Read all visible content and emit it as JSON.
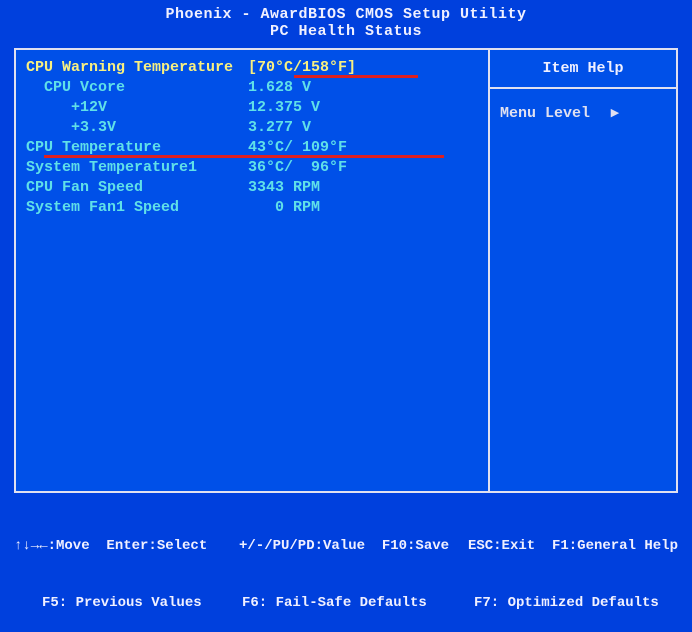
{
  "header": {
    "line1": "Phoenix - AwardBIOS CMOS Setup Utility",
    "line2": "PC Health Status"
  },
  "items": [
    {
      "label": "CPU Warning Temperature",
      "value": "[70°C/158°F]",
      "labelClass": "yellow",
      "valueClass": "yellow",
      "indent": 0,
      "hl": "underline1"
    },
    {
      "label": "CPU Vcore",
      "value": "1.628 V",
      "labelClass": "cyan",
      "valueClass": "cyan",
      "indent": 2
    },
    {
      "label": "+12V",
      "value": "12.375 V",
      "labelClass": "cyan",
      "valueClass": "cyan",
      "indent": 5
    },
    {
      "label": "+3.3V",
      "value": "3.277 V",
      "labelClass": "cyan",
      "valueClass": "cyan",
      "indent": 5
    },
    {
      "label": "CPU Temperature",
      "value": "43°C/ 109°F",
      "labelClass": "cyan",
      "valueClass": "cyan",
      "indent": 0,
      "hl": "underline2"
    },
    {
      "label": "System Temperature1",
      "value": "36°C/  96°F",
      "labelClass": "cyan",
      "valueClass": "cyan",
      "indent": 0
    },
    {
      "label": "CPU Fan Speed",
      "value": "3343 RPM",
      "labelClass": "cyan",
      "valueClass": "cyan",
      "indent": 0
    },
    {
      "label": "System Fan1 Speed",
      "value": "   0 RPM",
      "labelClass": "cyan",
      "valueClass": "cyan",
      "indent": 0
    }
  ],
  "help": {
    "title": "Item Help",
    "menuLevel": "Menu Level",
    "chevron": "▸"
  },
  "footer": {
    "r1c1": "↑↓→←:Move  Enter:Select",
    "r1c2": "+/-/PU/PD:Value  F10:Save",
    "r1c3": "ESC:Exit  F1:General Help",
    "r2c1": "F5: Previous Values",
    "r2c2": "F6: Fail-Safe Defaults",
    "r2c3": "F7: Optimized Defaults"
  }
}
